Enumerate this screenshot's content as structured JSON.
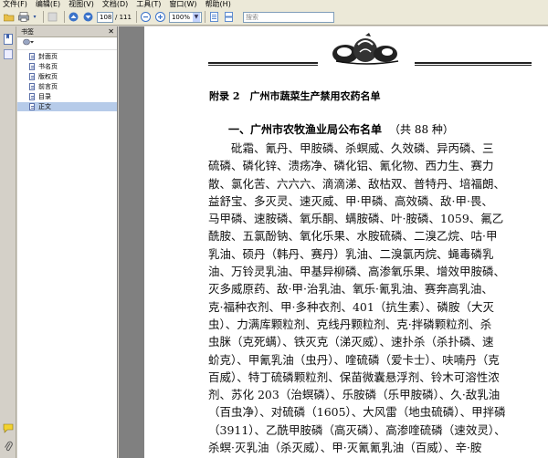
{
  "menubar": {
    "items": [
      "文件(F)",
      "编辑(E)",
      "视图(V)",
      "文档(D)",
      "工具(T)",
      "窗口(W)",
      "帮助(H)"
    ]
  },
  "toolbar": {
    "page_current": "108",
    "page_total": "/ 111",
    "zoom": "100%",
    "search_placeholder": "搜索"
  },
  "bookmarks": {
    "title": "书签",
    "items": [
      {
        "label": "封面页"
      },
      {
        "label": "书名页"
      },
      {
        "label": "版权页"
      },
      {
        "label": "前言页"
      },
      {
        "label": "目录"
      },
      {
        "label": "正文"
      }
    ]
  },
  "document": {
    "appendix_title": "附录 2　广州市蔬菜生产禁用农药名单",
    "section_heading": "一、广州市农牧渔业局公布名单",
    "section_count": "（共 88 种）",
    "lines": [
      "砒霜、氰丹、甲胺磷、杀螟威、久效磷、异丙磷、三",
      "硫磷、磷化锌、溃疡净、磷化铝、氰化物、西力生、赛力",
      "散、氯化苦、六六六、滴滴涕、敌枯双、普特丹、培福朗、",
      "益舒宝、多灭灵、速灭威、甲·甲磷、高效磷、敌·甲·畏、",
      "马甲磷、速胺磷、氧乐酮、螨胺磷、叶·胺磷、1059、氟乙",
      "酰胺、五氯酚钠、氧化乐果、水胺硫磷、二溴乙烷、咕·甲",
      "乳油、硕丹（韩丹、赛丹）乳油、二溴氯丙烷、蝇毒磷乳",
      "油、万铃灵乳油、甲基异柳磷、高渗氧乐果、增效甲胺磷、",
      "灭多威原药、敌·甲·治乳油、氧乐·氰乳油、赛奔高乳油、",
      "克·福种衣剂、甲·多种衣剂、401（抗生素）、磷胺（大灭",
      "虫）、力满库颗粒剂、克线丹颗粒剂、克·拌磷颗粒剂、杀",
      "虫脒（克死螨）、铁灭克（涕灭威）、速扑杀（杀扑磷、速",
      "蚧克）、甲氰乳油（虫丹）、喹硫磷（爱卡士）、呋喃丹（克",
      "百威）、特丁硫磷颗粒剂、保苗微囊悬浮剂、铃木可溶性浓",
      "剂、苏化 203（治螟磷）、乐胺磷（乐甲胺磷）、久·敌乳油",
      "（百虫净）、对硫磷（1605）、大风雷（地虫硫磷）、甲拌磷",
      "（3911）、乙酰甲胺磷（高灭磷）、高渗喹硫磷（速效灵）、",
      "杀螟·灭乳油（杀灭威）、甲·灭氰氰乳油（百威）、辛·胺"
    ]
  }
}
